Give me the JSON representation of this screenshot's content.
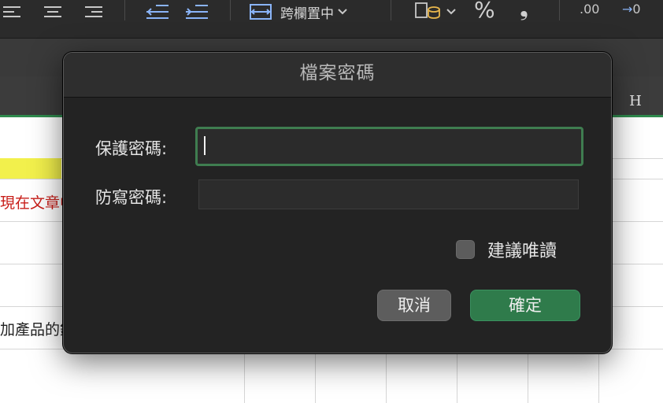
{
  "toolbar": {
    "merge_label": "跨欄置中",
    "percent_symbol": "%",
    "comma_symbol": "❟",
    "decimal_increase_label": ".00",
    "decimal_decrease_label": "0"
  },
  "sheet": {
    "column_letter": "H",
    "cell_red_text": "現在文章中",
    "cell_black_text": "加產品的銷"
  },
  "dialog": {
    "title": "檔案密碼",
    "protect_label": "保護密碼:",
    "protect_value": "",
    "write_label": "防寫密碼:",
    "write_value": "",
    "readonly_label": "建議唯讀",
    "readonly_checked": false,
    "cancel_label": "取消",
    "ok_label": "確定"
  },
  "colors": {
    "accent_green": "#2f7b4b",
    "focus_ring": "#3f7d50",
    "red_text": "#c81d18",
    "yellow_fill": "#f2f04c"
  }
}
